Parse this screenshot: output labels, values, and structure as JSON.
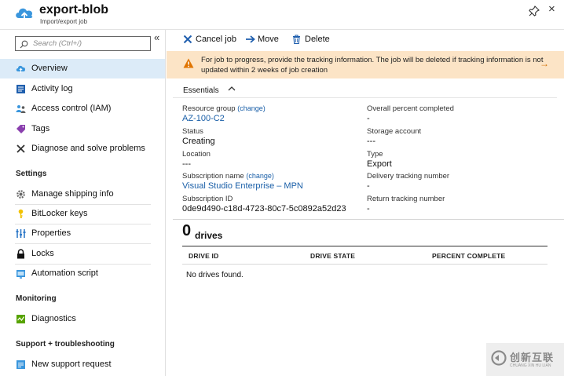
{
  "header": {
    "title": "export-blob",
    "subtitle": "Import/export job",
    "close_glyph": "×"
  },
  "sidebar": {
    "search_placeholder": "Search (Ctrl+/)",
    "collapse_glyph": "«",
    "items": [
      {
        "label": "Overview",
        "icon": "cloud-icon"
      },
      {
        "label": "Activity log",
        "icon": "activity-log-icon"
      },
      {
        "label": "Access control (IAM)",
        "icon": "people-icon"
      },
      {
        "label": "Tags",
        "icon": "tag-icon"
      },
      {
        "label": "Diagnose and solve problems",
        "icon": "wrench-icon"
      }
    ],
    "sections": {
      "settings": {
        "title": "Settings",
        "items": [
          {
            "label": "Manage shipping info",
            "icon": "gear-icon"
          },
          {
            "label": "BitLocker keys",
            "icon": "key-icon"
          },
          {
            "label": "Properties",
            "icon": "properties-icon"
          },
          {
            "label": "Locks",
            "icon": "lock-icon"
          },
          {
            "label": "Automation script",
            "icon": "automation-icon"
          }
        ]
      },
      "monitoring": {
        "title": "Monitoring",
        "items": [
          {
            "label": "Diagnostics",
            "icon": "diagnostics-icon"
          }
        ]
      },
      "support": {
        "title": "Support + troubleshooting",
        "items": [
          {
            "label": "New support request",
            "icon": "support-icon"
          }
        ]
      }
    }
  },
  "toolbar": {
    "cancel_label": "Cancel job",
    "move_label": "Move",
    "delete_label": "Delete"
  },
  "warning": {
    "text": "For job to progress, provide the tracking information. The job will be deleted if tracking information is not updated within 2 weeks of job creation",
    "arrow_glyph": "→"
  },
  "essentials": {
    "title": "Essentials",
    "change_label": "(change)",
    "left": {
      "resource_group_label": "Resource group",
      "resource_group_value": "AZ-100-C2",
      "status_label": "Status",
      "status_value": "Creating",
      "location_label": "Location",
      "location_value": "---",
      "subscription_name_label": "Subscription name",
      "subscription_name_value": "Visual Studio Enterprise – MPN",
      "subscription_id_label": "Subscription ID",
      "subscription_id_value": "0de9d490-c18d-4723-80c7-5c0892a52d23"
    },
    "right": {
      "percent_label": "Overall percent completed",
      "percent_value": "-",
      "storage_label": "Storage account",
      "storage_value": "---",
      "type_label": "Type",
      "type_value": "Export",
      "delivery_label": "Delivery tracking number",
      "delivery_value": "-",
      "return_label": "Return tracking number",
      "return_value": "-"
    }
  },
  "drives": {
    "count": "0",
    "label": "drives",
    "columns": [
      "DRIVE ID",
      "DRIVE STATE",
      "PERCENT COMPLETE"
    ],
    "empty_text": "No drives found."
  },
  "watermark": {
    "main": "创新互联",
    "sub": "CHUANG XIN HU LIAN"
  },
  "colors": {
    "accent": "#1a5fa8",
    "selected_bg": "#dcebf8",
    "warning_bg": "#fce4c6",
    "warning_icon": "#e07400"
  }
}
